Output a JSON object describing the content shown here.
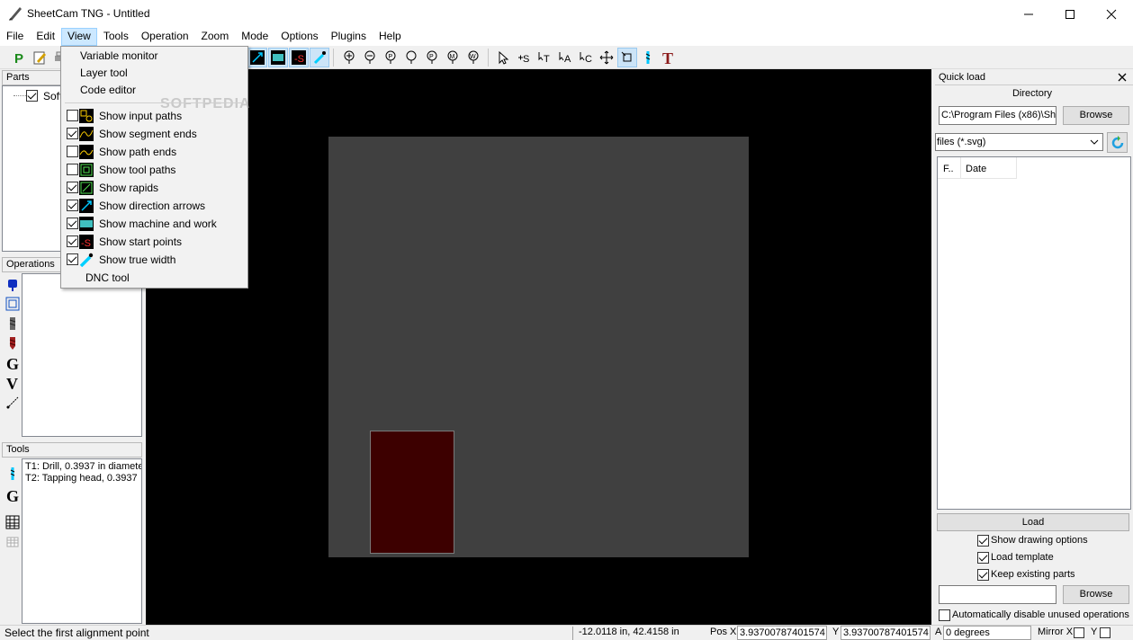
{
  "window": {
    "title": "SheetCam TNG - Untitled"
  },
  "menu": [
    "File",
    "Edit",
    "View",
    "Tools",
    "Operation",
    "Zoom",
    "Mode",
    "Options",
    "Plugins",
    "Help"
  ],
  "view_menu": {
    "top_items": [
      "Variable monitor",
      "Layer tool",
      "Code editor"
    ],
    "toggles": [
      {
        "label": "Show input paths",
        "checked": false
      },
      {
        "label": "Show segment ends",
        "checked": true
      },
      {
        "label": "Show path ends",
        "checked": false
      },
      {
        "label": "Show tool paths",
        "checked": false
      },
      {
        "label": "Show rapids",
        "checked": true
      },
      {
        "label": "Show direction arrows",
        "checked": true
      },
      {
        "label": "Show machine and work",
        "checked": true
      },
      {
        "label": "Show start points",
        "checked": true
      },
      {
        "label": "Show true width",
        "checked": true
      }
    ],
    "bottom_item": "DNC tool"
  },
  "parts_panel": {
    "title": "Parts",
    "items": [
      {
        "label": "Soft",
        "checked": true
      }
    ]
  },
  "operations_panel": {
    "title": "Operations"
  },
  "tools_panel": {
    "title": "Tools",
    "items": [
      "T1: Drill, 0.3937 in diamete",
      "T2: Tapping head, 0.3937"
    ]
  },
  "quick_load": {
    "title": "Quick load",
    "directory_label": "Directory",
    "directory_value": "C:\\Program Files (x86)\\She",
    "browse_label": "Browse",
    "filter_value": "files (*.svg)",
    "columns": [
      "F..",
      "Date"
    ],
    "load_label": "Load",
    "options": [
      {
        "label": "Show drawing options",
        "checked": true
      },
      {
        "label": "Load template",
        "checked": true
      },
      {
        "label": "Keep existing parts",
        "checked": true
      }
    ],
    "browse2_label": "Browse",
    "auto_disable": {
      "label": "Automatically disable unused operations",
      "checked": false
    }
  },
  "status": {
    "message": "Select the first alignment point",
    "coords": "-12.0118 in, 42.4158 in",
    "pos_x_label": "Pos X",
    "pos_x": "3.93700787401574",
    "y_label": "Y",
    "pos_y": "3.93700787401574",
    "a_label": "A",
    "angle": "0 degrees",
    "mirror_x_label": "Mirror X",
    "mirror_y_label": "Y"
  },
  "watermark": "SOFTPEDIA",
  "colors": {
    "canvas": "#000000",
    "sheet": "#404040",
    "part": "#3d0000",
    "accent": "#cce8ff"
  }
}
